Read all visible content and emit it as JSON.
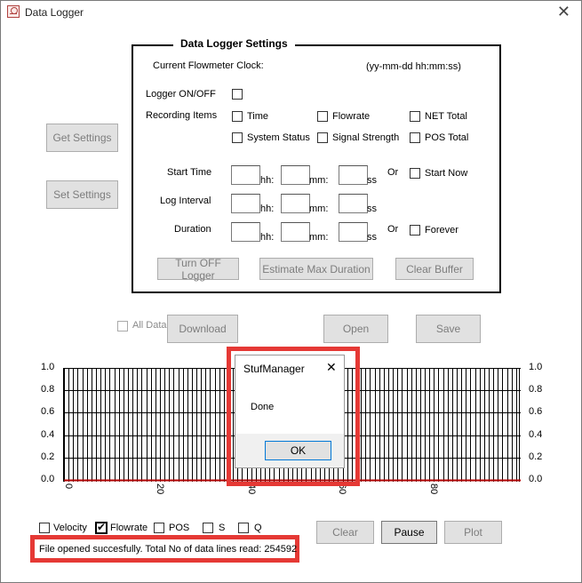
{
  "window": {
    "title": "Data Logger",
    "close_glyph": "✕"
  },
  "settings": {
    "group_title": "Data Logger Settings",
    "clock_label": "Current Flowmeter Clock:",
    "clock_format": "(yy-mm-dd hh:mm:ss)",
    "logger_label": "Logger ON/OFF",
    "recording_label": "Recording Items",
    "items": [
      "Time",
      "Flowrate",
      "NET Total",
      "System Status",
      "Signal Strength",
      "POS Total"
    ],
    "start_time_label": "Start Time",
    "log_interval_label": "Log Interval",
    "duration_label": "Duration",
    "unit_hh": "hh:",
    "unit_mm": "mm:",
    "unit_ss": "ss",
    "or_label": "Or",
    "start_now_label": "Start Now",
    "forever_label": "Forever",
    "turn_off_label": "Turn OFF Logger",
    "estimate_label": "Estimate Max Duration",
    "clear_buffer_label": "Clear Buffer"
  },
  "left_buttons": {
    "get_settings": "Get Settings",
    "set_settings": "Set Settings"
  },
  "data_row": {
    "all_data_label": "All Data",
    "download": "Download",
    "open": "Open",
    "save": "Save"
  },
  "chart_data": {
    "type": "line",
    "y_ticks": [
      "1.0",
      "0.8",
      "0.6",
      "0.4",
      "0.2",
      "0.0"
    ],
    "x_ticks": [
      "0",
      "20",
      "40",
      "60",
      "80"
    ],
    "ylim": [
      0,
      1
    ],
    "grid": true,
    "line_color": "#b00000"
  },
  "bottom": {
    "velocity": "Velocity",
    "flowrate": "Flowrate",
    "pos": "POS",
    "s": "S",
    "q": "Q",
    "clear": "Clear",
    "pause": "Pause",
    "plot": "Plot",
    "status": "File opened succesfully. Total No of data lines read: 254592"
  },
  "dialog": {
    "title": "StufManager",
    "message": "Done",
    "ok": "OK",
    "close_glyph": "✕"
  },
  "colors": {
    "highlight": "#e53935",
    "series": "#b00000"
  }
}
